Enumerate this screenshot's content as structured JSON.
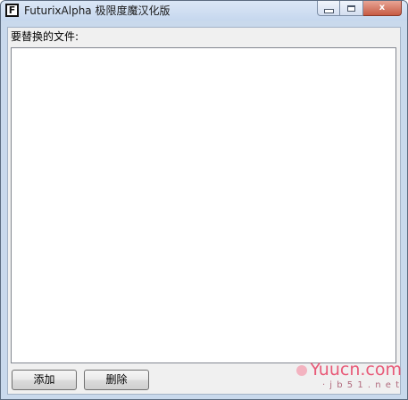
{
  "window": {
    "title": "FuturixAlpha 极限度魔汉化版",
    "icon_letter": "F",
    "icon": "app-f-icon",
    "caption_icons": [
      "minimize-icon",
      "maximize-icon",
      "close-icon"
    ],
    "close_glyph": "x"
  },
  "main": {
    "list_label": "要替换的文件:",
    "files": []
  },
  "buttons": {
    "add_label": "添加",
    "delete_label": "删除"
  },
  "watermark": {
    "text": "Yuucn.com",
    "subtext": "· j b 5 1 . n e t"
  },
  "colors": {
    "titlebar": "#c6d7ee",
    "close_button": "#c75b44",
    "watermark": "#e85a78"
  }
}
